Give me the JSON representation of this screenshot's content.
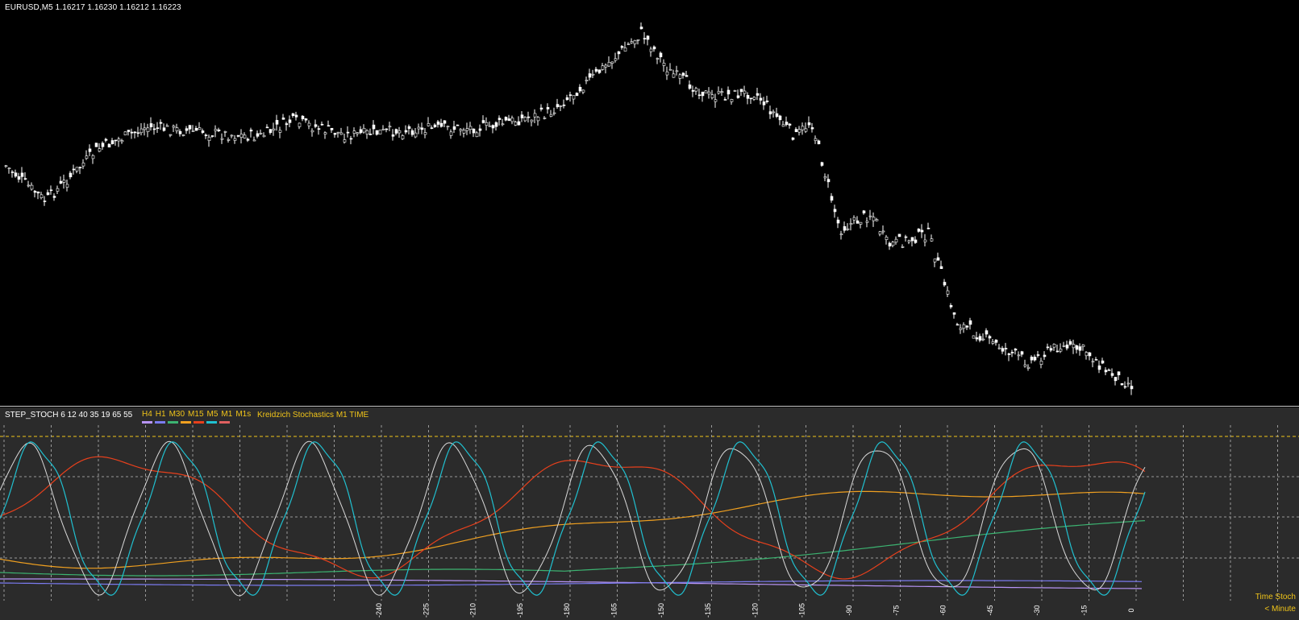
{
  "main": {
    "symbol_line": "EURUSD,M5  1.16217 1.16230 1.16212 1.16223",
    "candle_color": "#ffffff"
  },
  "sub": {
    "indicator_params": "STEP_STOCH 6 12 40 35 19 65 55",
    "timeframes": [
      {
        "label": "H4",
        "color": "#b794f6"
      },
      {
        "label": "H1",
        "color": "#7b7bf0"
      },
      {
        "label": "M30",
        "color": "#3cb371"
      },
      {
        "label": "M15",
        "color": "#f0a020"
      },
      {
        "label": "M5",
        "color": "#e8401c"
      },
      {
        "label": "M1",
        "color": "#20c0d0"
      },
      {
        "label": "M1s",
        "color": "#e06060"
      }
    ],
    "indicator_name": "Kreidzich Stochastics  M1 TIME",
    "x_labels": [
      "-240",
      "-225",
      "-210",
      "-195",
      "-180",
      "-165",
      "-150",
      "-135",
      "-120",
      "-105",
      "-90",
      "-75",
      "-60",
      "-45",
      "-30",
      "-15",
      "0"
    ],
    "corner_top": "Time Stoch",
    "corner_bottom": "< Minute",
    "level_color": "#f0c419",
    "grid_color": "#9a9a9a"
  }
}
